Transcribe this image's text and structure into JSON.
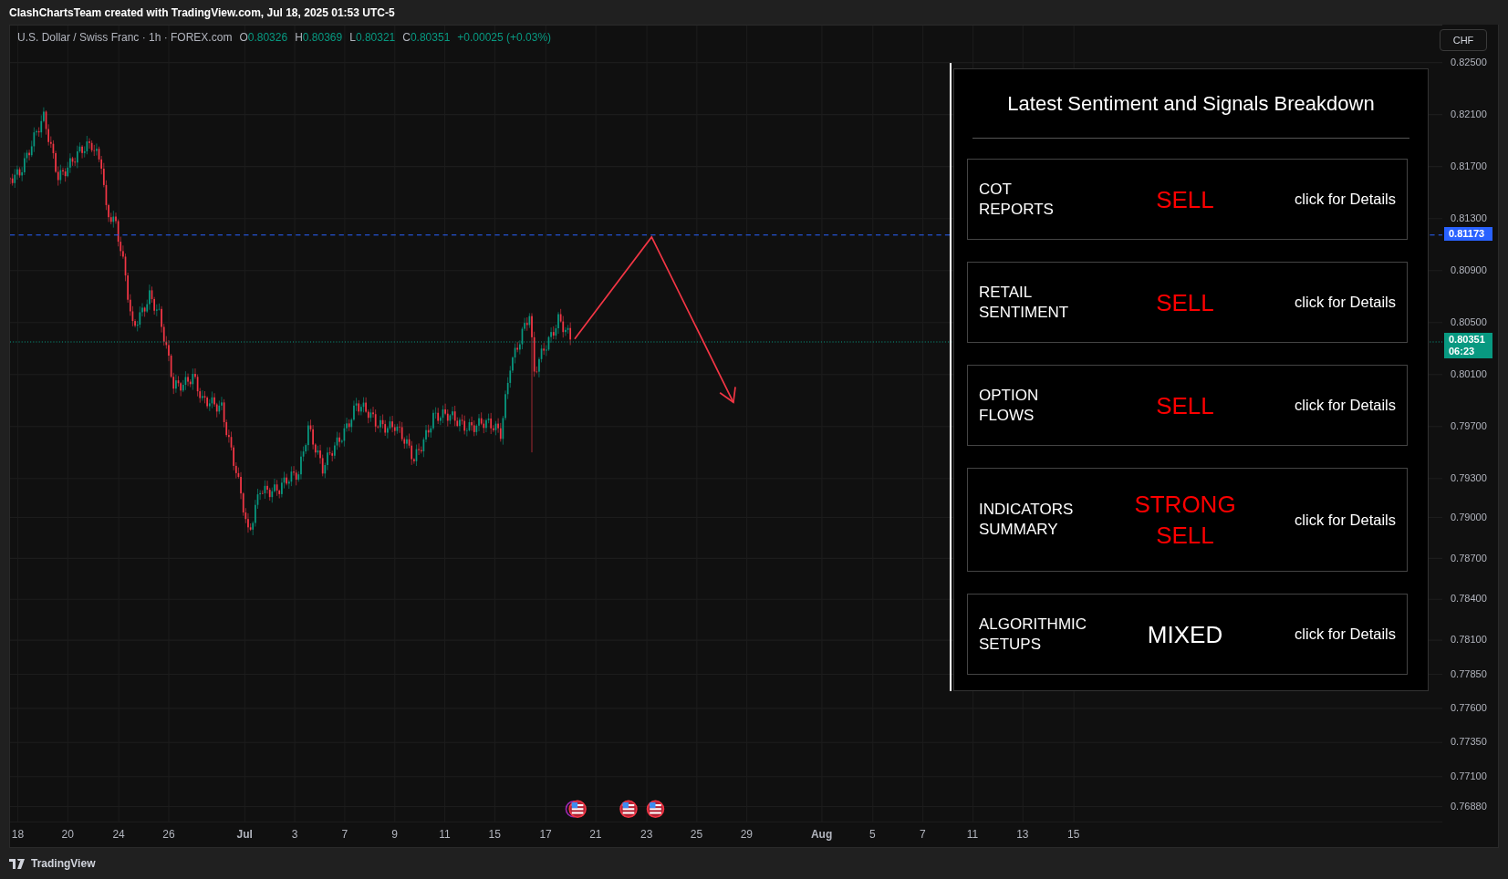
{
  "header": {
    "title": "ClashChartsTeam created with TradingView.com, Jul 18, 2025 01:53 UTC-5"
  },
  "legend": {
    "symbol": "U.S. Dollar / Swiss Franc · 1h · FOREX.com",
    "ohlc": [
      {
        "label": "O",
        "value": "0.80326"
      },
      {
        "label": "H",
        "value": "0.80369"
      },
      {
        "label": "L",
        "value": "0.80321"
      },
      {
        "label": "C",
        "value": "0.80351"
      }
    ],
    "change": "+0.00025 (+0.03%)"
  },
  "price_axis": {
    "currency": "CHF",
    "ticks": [
      "0.82500",
      "0.82100",
      "0.81700",
      "0.81300",
      "0.80900",
      "0.80500",
      "0.80100",
      "0.79700",
      "0.79300",
      "0.79000",
      "0.78700",
      "0.78400",
      "0.78100",
      "0.77850",
      "0.77600",
      "0.77350",
      "0.77100",
      "0.76880"
    ],
    "markers": [
      {
        "kind": "level",
        "price": "0.81173"
      },
      {
        "kind": "last",
        "price": "0.80351",
        "countdown": "06:23"
      }
    ]
  },
  "time_axis": {
    "labels": [
      {
        "text": "18",
        "bold": false
      },
      {
        "text": "20",
        "bold": false
      },
      {
        "text": "24",
        "bold": false
      },
      {
        "text": "26",
        "bold": false
      },
      {
        "text": "Jul",
        "bold": true
      },
      {
        "text": "3",
        "bold": false
      },
      {
        "text": "7",
        "bold": false
      },
      {
        "text": "9",
        "bold": false
      },
      {
        "text": "11",
        "bold": false
      },
      {
        "text": "15",
        "bold": false
      },
      {
        "text": "17",
        "bold": false
      },
      {
        "text": "21",
        "bold": false
      },
      {
        "text": "23",
        "bold": false
      },
      {
        "text": "25",
        "bold": false
      },
      {
        "text": "29",
        "bold": false
      },
      {
        "text": "Aug",
        "bold": true
      },
      {
        "text": "5",
        "bold": false
      },
      {
        "text": "7",
        "bold": false
      },
      {
        "text": "11",
        "bold": false
      },
      {
        "text": "13",
        "bold": false
      },
      {
        "text": "15",
        "bold": false
      }
    ]
  },
  "panel": {
    "title": "Latest Sentiment and Signals Breakdown",
    "rows": [
      {
        "label": "COT\nREPORTS",
        "signal": "SELL",
        "color": "#ff0000",
        "link": "click for Details"
      },
      {
        "label": "RETAIL\nSENTIMENT",
        "signal": "SELL",
        "color": "#ff0000",
        "link": "click for Details"
      },
      {
        "label": "OPTION\nFLOWS",
        "signal": "SELL",
        "color": "#ff0000",
        "link": "click for Details"
      },
      {
        "label": "INDICATORS\nSUMMARY",
        "signal": "STRONG\nSELL",
        "color": "#ff0000",
        "link": "click for Details"
      },
      {
        "label": "ALGORITHMIC\nSETUPS",
        "signal": "MIXED",
        "color": "#ffffff",
        "link": "click for Details"
      }
    ]
  },
  "footer": {
    "brand": "TradingView"
  }
}
